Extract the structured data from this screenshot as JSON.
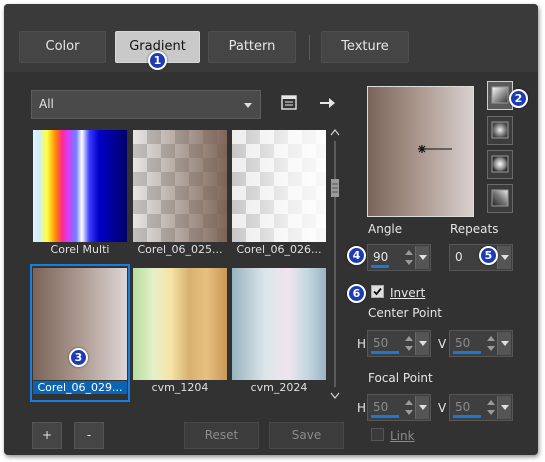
{
  "tabs": [
    {
      "label": "Color",
      "active": false
    },
    {
      "label": "Gradient",
      "active": true
    },
    {
      "label": "Pattern",
      "active": false
    },
    {
      "label": "Texture",
      "active": false
    }
  ],
  "category_dropdown": {
    "selected": "All"
  },
  "toolbar_icons": [
    "gradient-editor-icon",
    "arrow-right-icon"
  ],
  "gradients": [
    {
      "name": "Corel Multi",
      "selected": false
    },
    {
      "name": "Corel_06_025...",
      "selected": false
    },
    {
      "name": "Corel_06_026...",
      "selected": false
    },
    {
      "name": "Corel_06_029...",
      "selected": true
    },
    {
      "name": "cvm_1204",
      "selected": false
    },
    {
      "name": "cvm_2024",
      "selected": false
    }
  ],
  "style_buttons": [
    "linear-gradient-icon",
    "rectangular-gradient-icon",
    "sunburst-gradient-icon",
    "radial-gradient-icon"
  ],
  "angle": {
    "label": "Angle",
    "value": "90"
  },
  "repeats": {
    "label": "Repeats",
    "value": "0"
  },
  "invert": {
    "label": "Invert",
    "checked": true
  },
  "center_point": {
    "label": "Center Point",
    "h_label": "H",
    "h_value": "50",
    "v_label": "V",
    "v_value": "50"
  },
  "focal_point": {
    "label": "Focal Point",
    "h_label": "H",
    "h_value": "50",
    "v_label": "V",
    "v_value": "50"
  },
  "link": {
    "label": "Link",
    "checked": false
  },
  "buttons": {
    "add": "+",
    "remove": "-",
    "reset": "Reset",
    "save": "Save"
  },
  "badges": [
    "1",
    "2",
    "3",
    "4",
    "5",
    "6"
  ],
  "colors": {
    "accent": "#1a7ee0",
    "badge": "#1d3bb5",
    "panel": "#323232"
  }
}
